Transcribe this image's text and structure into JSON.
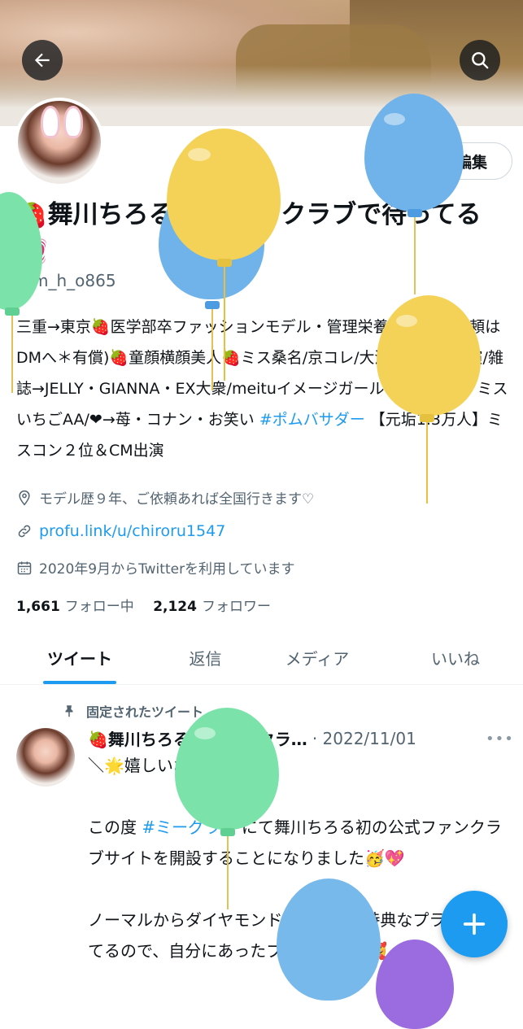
{
  "header": {
    "back_icon": "arrow-left-icon",
    "search_icon": "search-icon",
    "edit_label": "編集"
  },
  "profile": {
    "name": "🍓舞川ちろる🐼ファンクラブで待ってる💓",
    "handle": "@m_h_o865",
    "bio": "三重→東京🍓医学部卒ファッションモデル・管理栄養士🍓撮影依頼はDMへ＊有償)🍓童顔横顔美人🍓ミス桑名/京コレ/大河いだてん出演/雑誌→JELLY・GIANNA・EX大衆/meituイメージガール・浅草姫８・ミスいちごAA/❤→苺・コナン・お笑い ",
    "bio_hashtag": "#ポムバサダー",
    "bio_tail": " 【元垢1.3万人】ミスコン２位＆CM出演",
    "location": "モデル歴９年、ご依頼あれば全国行きます♡",
    "url": "profu.link/u/chiroru1547",
    "joined": "2020年9月からTwitterを利用しています",
    "following_count": "1,661",
    "following_label": "フォロー中",
    "followers_count": "2,124",
    "followers_label": "フォロワー"
  },
  "tabs": [
    {
      "label": "ツイート"
    },
    {
      "label": "返信"
    },
    {
      "label": "メディア"
    },
    {
      "label": "いいね"
    }
  ],
  "tweet": {
    "pinned_label": "固定されたツイート",
    "author": "🍓舞川ちろる🐼ファンクラ…",
    "date": "· 2022/11/01",
    "more": "•••",
    "line1": "＼🌟嬉しいお知らせ🌟／",
    "line2a": "この度 ",
    "line2_hashtag": "#ミーグラム",
    "line2b": " にて舞川ちろる初の公式ファンクラブサイトを開設することになりました🥳💖",
    "line3": "ノーマルからダイヤモンドまで様々な特典なプランとなってるので、自分にあったプ選んでね🙌🥰"
  },
  "fab": {
    "icon": "plus-icon"
  },
  "colors": {
    "accent": "#1d9bf0",
    "text": "#0f1419",
    "muted": "#536471"
  }
}
